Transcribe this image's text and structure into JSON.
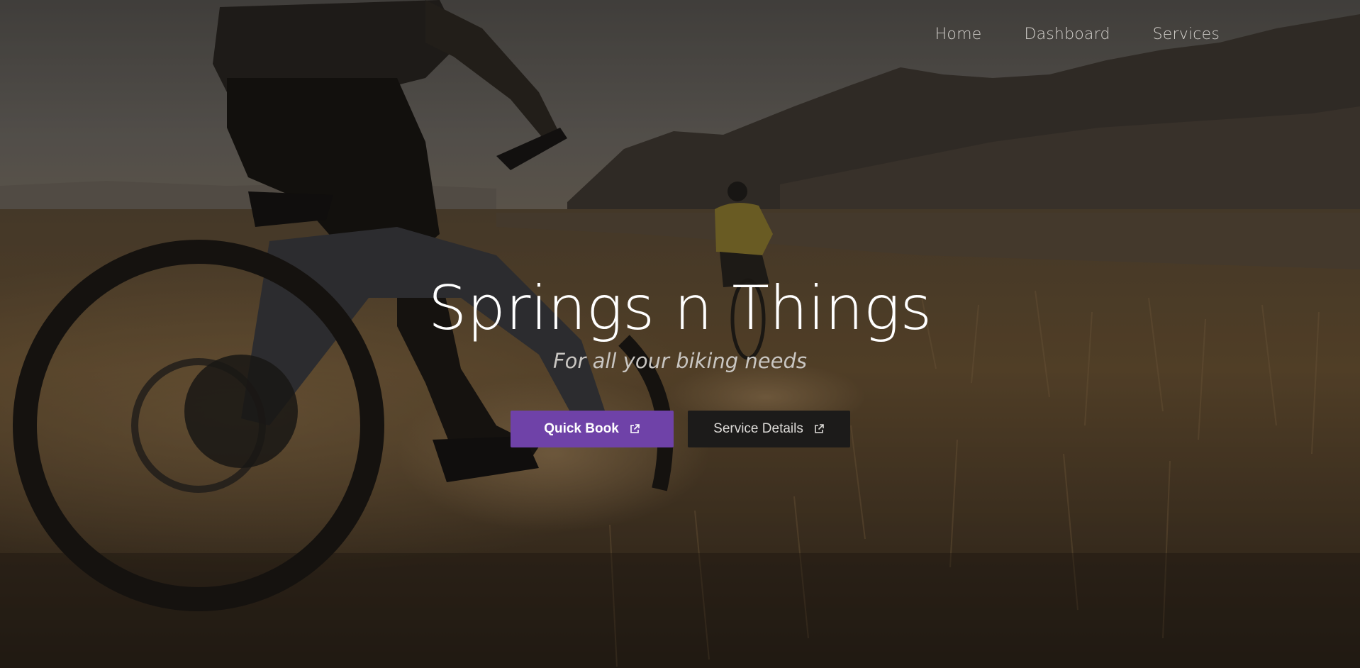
{
  "nav": {
    "items": [
      {
        "label": "Home"
      },
      {
        "label": "Dashboard"
      },
      {
        "label": "Services"
      }
    ]
  },
  "hero": {
    "title": "Springs n Things",
    "subtitle": "For all your biking needs",
    "background_image": "mountain-bikers-on-grassy-trail-at-sunset"
  },
  "buttons": {
    "quick_book": {
      "label": "Quick Book",
      "icon": "external-link-icon"
    },
    "service_details": {
      "label": "Service Details",
      "icon": "external-link-icon"
    }
  },
  "colors": {
    "accent": "#6f42a8",
    "secondary_button": "#1c1b1a",
    "title_text": "#ffffff",
    "nav_text": "#d3d0cc"
  }
}
